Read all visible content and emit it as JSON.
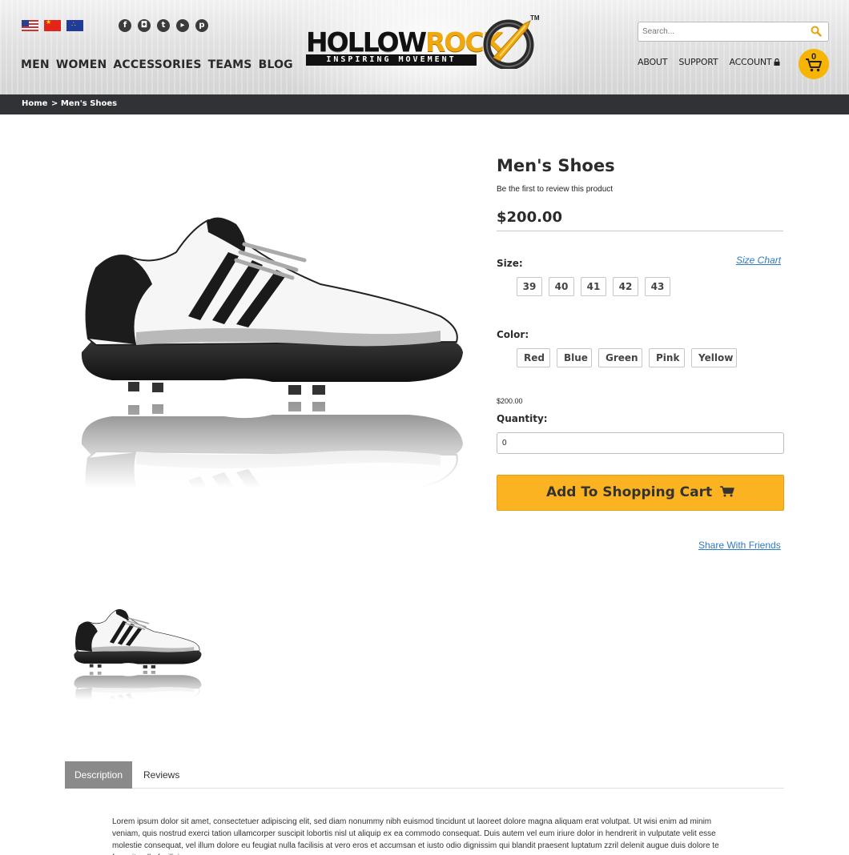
{
  "header": {
    "flags": [
      "us-flag",
      "cn-flag",
      "eu-flag"
    ],
    "socials": [
      {
        "icon": "facebook-icon",
        "glyph": "f"
      },
      {
        "icon": "instagram-icon",
        "glyph": "◘"
      },
      {
        "icon": "twitter-icon",
        "glyph": "t"
      },
      {
        "icon": "youtube-icon",
        "glyph": "▸"
      },
      {
        "icon": "pinterest-icon",
        "glyph": "p"
      }
    ],
    "main_nav": [
      "MEN",
      "WOMEN",
      "ACCESSORIES",
      "TEAMS",
      "BLOG"
    ],
    "logo": {
      "word_1": "HOLLOW",
      "word_2": "ROCK",
      "tagline": "INSPIRING MOVEMENT",
      "tm": "TM"
    },
    "search": {
      "placeholder": "Search..."
    },
    "top_nav": {
      "about": "ABOUT",
      "support": "SUPPORT",
      "account": "ACCOUNT"
    },
    "cart_count": "0"
  },
  "breadcrumb": {
    "home": "Home",
    "current": "> Men's Shoes"
  },
  "product": {
    "title": "Men's Shoes",
    "review_text": "Be the first to review this product",
    "price": "$200.00",
    "size_label": "Size:",
    "size_chart": "Size Chart",
    "sizes": [
      "39",
      "40",
      "41",
      "42",
      "43"
    ],
    "color_label": "Color:",
    "colors": [
      "Red",
      "Blue",
      "Green",
      "Pink",
      "Yellow"
    ],
    "small_price": "$200.00",
    "quantity_label": "Quantity:",
    "quantity_value": "0",
    "add_to_cart": "Add To Shopping Cart",
    "share": "Share With Friends"
  },
  "tabs": {
    "description": "Description",
    "reviews": "Reviews"
  },
  "description_text": "Lorem ipsum dolor sit amet, consectetuer adipiscing elit, sed diam nonummy nibh euismod tincidunt ut laoreet dolore magna aliquam erat volutpat. Ut wisi enim ad minim veniam, quis nostrud exerci tation ullamcorper suscipit lobortis nisl ut aliquip ex ea commodo consequat. Duis autem vel eum iriure dolor in hendrerit in vulputate velit esse molestie consequat, vel illum dolore eu feugiat nulla facilisis at vero eros et accumsan et iusto odio dignissim qui blandit praesent luptatum zzril delenit augue duis dolore te feugait nulla facilisi.",
  "colors": {
    "accent": "#fbb321",
    "breadcrumb_bg": "#313236",
    "link": "#2f7bc0",
    "tab_active": "#8a8a8a"
  }
}
